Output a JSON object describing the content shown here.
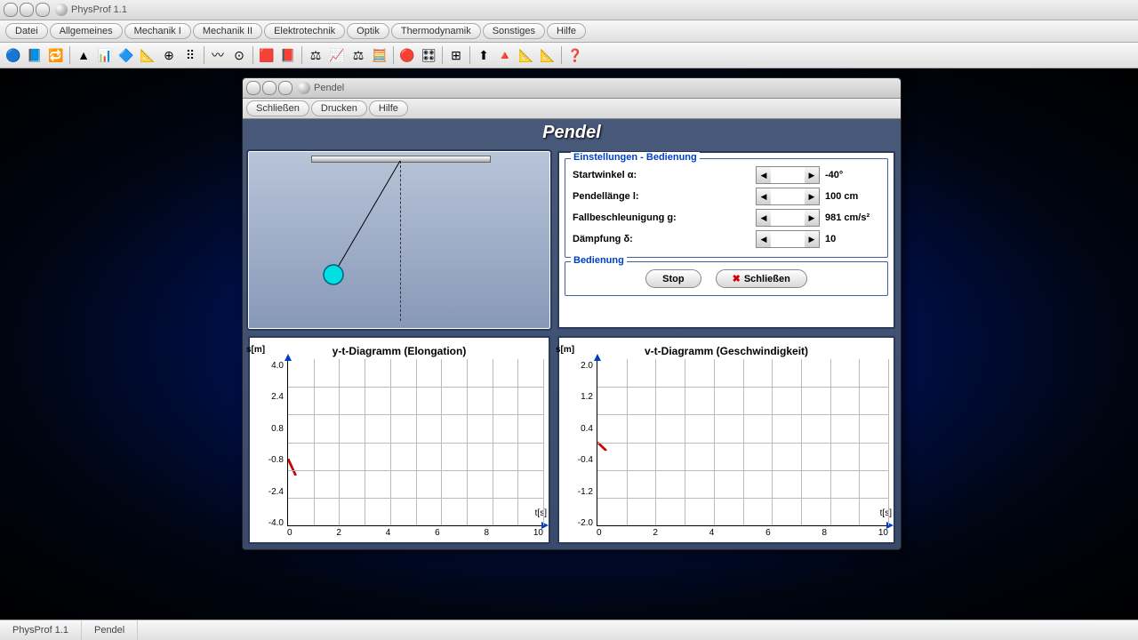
{
  "app": {
    "title": "PhysProf 1.1"
  },
  "menubar": [
    "Datei",
    "Allgemeines",
    "Mechanik I",
    "Mechanik II",
    "Elektrotechnik",
    "Optik",
    "Thermodynamik",
    "Sonstiges",
    "Hilfe"
  ],
  "toolbar_icons": [
    "🔵",
    "📘",
    "🔁",
    "|",
    "▲",
    "📊",
    "🔷",
    "📐",
    "⊕",
    "⠿",
    "|",
    "〰",
    "⊙",
    "|",
    "🟥",
    "📕",
    "|",
    "⚖",
    "📈",
    "⚖",
    "🧮",
    "|",
    "🔴",
    "🎛",
    "|",
    "⊞",
    "|",
    "⬆",
    "🔺",
    "📐",
    "📐",
    "|",
    "❓"
  ],
  "child": {
    "title": "Pendel",
    "menu": [
      "Schließen",
      "Drucken",
      "Hilfe"
    ],
    "banner": "Pendel"
  },
  "settings": {
    "legend": "Einstellungen - Bedienung",
    "rows": [
      {
        "label": "Startwinkel α:",
        "value": "-40°"
      },
      {
        "label": "Pendellänge l:",
        "value": "100 cm"
      },
      {
        "label": "Fallbeschleunigung g:",
        "value": "981 cm/s²"
      },
      {
        "label": "Dämpfung δ:",
        "value": "10"
      }
    ]
  },
  "controls": {
    "legend": "Bedienung",
    "stop": "Stop",
    "close": "Schließen"
  },
  "charts": {
    "left": {
      "title": "y-t-Diagramm (Elongation)",
      "ylabel": "s[m]",
      "xlabel": "t[s]",
      "yticks": [
        "4.0",
        "2.4",
        "0.8",
        "-0.8",
        "-2.4",
        "-4.0"
      ],
      "xticks": [
        "0",
        "2",
        "4",
        "6",
        "8",
        "10"
      ]
    },
    "right": {
      "title": "v-t-Diagramm (Geschwindigkeit)",
      "ylabel": "s[m]",
      "xlabel": "t[s]",
      "yticks": [
        "2.0",
        "1.2",
        "0.4",
        "-0.4",
        "-1.2",
        "-2.0"
      ],
      "xticks": [
        "0",
        "2",
        "4",
        "6",
        "8",
        "10"
      ]
    }
  },
  "chart_data": [
    {
      "type": "line",
      "title": "y-t-Diagramm (Elongation)",
      "xlabel": "t[s]",
      "ylabel": "s[m]",
      "xlim": [
        0,
        10
      ],
      "ylim": [
        -4.0,
        4.0
      ],
      "x": [
        0,
        0.3
      ],
      "values": [
        -0.8,
        -1.6
      ]
    },
    {
      "type": "line",
      "title": "v-t-Diagramm (Geschwindigkeit)",
      "xlabel": "t[s]",
      "ylabel": "s[m]",
      "xlim": [
        0,
        10
      ],
      "ylim": [
        -2.0,
        2.0
      ],
      "x": [
        0,
        0.3
      ],
      "values": [
        0.0,
        -0.2
      ]
    }
  ],
  "status": [
    "PhysProf 1.1",
    "Pendel"
  ]
}
